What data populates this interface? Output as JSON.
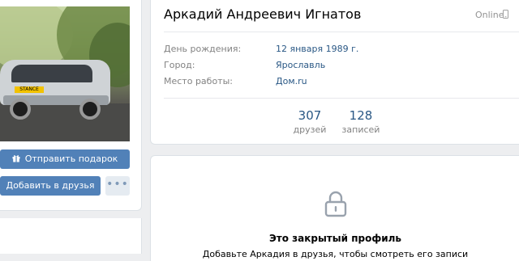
{
  "profile": {
    "name": "Аркадий Андреевич Игнатов",
    "status": "Online",
    "info": [
      {
        "label": "День рождения:",
        "value": "12 января 1989 г."
      },
      {
        "label": "Город:",
        "value": "Ярославль"
      },
      {
        "label": "Место работы:",
        "value": "Дом.ru"
      }
    ],
    "counters": [
      {
        "value": "307",
        "label": "друзей"
      },
      {
        "value": "128",
        "label": "записей"
      }
    ]
  },
  "actions": {
    "gift_label": "Отправить подарок",
    "add_friend_label": "Добавить в друзья",
    "more_label": "•••"
  },
  "avatar": {
    "plate_text": "STANCE"
  },
  "closed_profile": {
    "title": "Это закрытый профиль",
    "text": "Добавьте Аркадия в друзья, чтобы смотреть его записи"
  },
  "colors": {
    "accent": "#5181b8",
    "link": "#2a5885",
    "muted": "#828282",
    "background": "#edeef0"
  }
}
